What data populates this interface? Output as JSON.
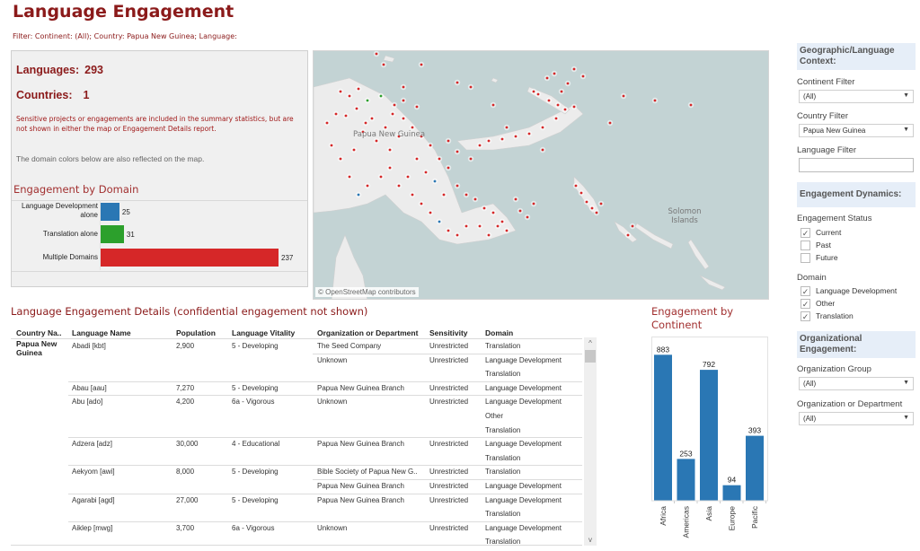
{
  "header": {
    "title": "Language Engagement",
    "filter_line": "Filter:  Continent: (All); Country: Papua New Guinea; Language:"
  },
  "summary": {
    "languages_label": "Languages:",
    "languages_value": "293",
    "countries_label": "Countries:",
    "countries_value": "1",
    "sensitive_note": "Sensitive projects or engagements are included in the summary statistics, but are not  shown in either the map or Engagement Details report.",
    "domain_colors_note": "The domain colors below are also reflected on the map."
  },
  "domain_chart": {
    "title": "Engagement by Domain",
    "items": [
      {
        "label": "Language Development alone",
        "value": 25,
        "display": "25",
        "color": "#2a77b4"
      },
      {
        "label": "Translation alone",
        "value": 31,
        "display": "31",
        "color": "#2ca02c"
      },
      {
        "label": "Multiple Domains",
        "value": 237,
        "display": "237",
        "color": "#d62728"
      }
    ],
    "max": 237
  },
  "map": {
    "attribution": "© OpenStreetMap contributors",
    "labels": {
      "png": "Papua New Guinea",
      "solomon": "Solomon Islands"
    },
    "water_color": "#c3d3d4",
    "land_color": "#ececec",
    "point_colors": {
      "multiple": "#d62728",
      "translation": "#2ca02c",
      "langdev": "#2a77b4"
    }
  },
  "details": {
    "title": "Language Engagement Details (confidential engagement not shown)",
    "columns": [
      "Country Na..",
      "Language Name",
      "Population",
      "Language Vitality",
      "Organization or Department",
      "Sensitivity",
      "Domain"
    ],
    "country": "Papua New Guinea",
    "languages": [
      {
        "name": "Abadi [kbt]",
        "population": "2,900",
        "vitality": "5 - Developing",
        "engagements": [
          {
            "org": "The Seed Company",
            "sensitivity": "Unrestricted",
            "domains": [
              "Translation"
            ]
          },
          {
            "org": "Unknown",
            "sensitivity": "Unrestricted",
            "domains": [
              "Language Development",
              "Translation"
            ]
          }
        ]
      },
      {
        "name": "Abau [aau]",
        "population": "7,270",
        "vitality": "5 - Developing",
        "engagements": [
          {
            "org": "Papua New Guinea Branch",
            "sensitivity": "Unrestricted",
            "domains": [
              "Language Development"
            ]
          }
        ]
      },
      {
        "name": "Abu [ado]",
        "population": "4,200",
        "vitality": "6a - Vigorous",
        "engagements": [
          {
            "org": "Unknown",
            "sensitivity": "Unrestricted",
            "domains": [
              "Language Development",
              "Other",
              "Translation"
            ]
          }
        ]
      },
      {
        "name": "Adzera [adz]",
        "population": "30,000",
        "vitality": "4 - Educational",
        "engagements": [
          {
            "org": "Papua New Guinea Branch",
            "sensitivity": "Unrestricted",
            "domains": [
              "Language Development",
              "Translation"
            ]
          }
        ]
      },
      {
        "name": "Aekyom [awi]",
        "population": "8,000",
        "vitality": "5 - Developing",
        "engagements": [
          {
            "org": "Bible Society of Papua New G..",
            "sensitivity": "Unrestricted",
            "domains": [
              "Translation"
            ]
          },
          {
            "org": "Papua New Guinea Branch",
            "sensitivity": "Unrestricted",
            "domains": [
              "Language Development"
            ]
          }
        ]
      },
      {
        "name": "Agarabi [agd]",
        "population": "27,000",
        "vitality": "5 - Developing",
        "engagements": [
          {
            "org": "Papua New Guinea Branch",
            "sensitivity": "Unrestricted",
            "domains": [
              "Language Development",
              "Translation"
            ]
          }
        ]
      },
      {
        "name": "Aiklep [mwg]",
        "population": "3,700",
        "vitality": "6a - Vigorous",
        "engagements": [
          {
            "org": "Unknown",
            "sensitivity": "Unrestricted",
            "domains": [
              "Language Development",
              "Translation"
            ]
          }
        ]
      }
    ],
    "scroll_up": "^",
    "scroll_down": "v"
  },
  "chart_data": {
    "type": "bar",
    "title": "Engagement by Continent",
    "categories": [
      "Africa",
      "Americas",
      "Asia",
      "Europe",
      "Pacific"
    ],
    "values": [
      883,
      253,
      792,
      94,
      393
    ],
    "color": "#2a77b4",
    "xlabel": "",
    "ylabel": "",
    "ylim": [
      0,
      950
    ],
    "grid": false
  },
  "sidebar": {
    "geo_header": "Geographic/Language Context:",
    "continent_label": "Continent Filter",
    "continent_value": "(All)",
    "country_label": "Country Filter",
    "country_value": "Papua New Guinea",
    "language_label": "Language Filter",
    "language_value": "",
    "dyn_header": "Engagement Dynamics:",
    "status_label": "Engagement Status",
    "status_options": [
      {
        "label": "Current",
        "checked": true
      },
      {
        "label": "Past",
        "checked": false
      },
      {
        "label": "Future",
        "checked": false
      }
    ],
    "domain_label": "Domain",
    "domain_options": [
      {
        "label": "Language Development",
        "checked": true
      },
      {
        "label": "Other",
        "checked": true
      },
      {
        "label": "Translation",
        "checked": true
      }
    ],
    "org_header": "Organizational Engagement:",
    "org_group_label": "Organization Group",
    "org_group_value": "(All)",
    "org_dept_label": "Organization or Department",
    "org_dept_value": "(All)",
    "dropdown_arrow": "▼",
    "check_mark": "✓"
  }
}
